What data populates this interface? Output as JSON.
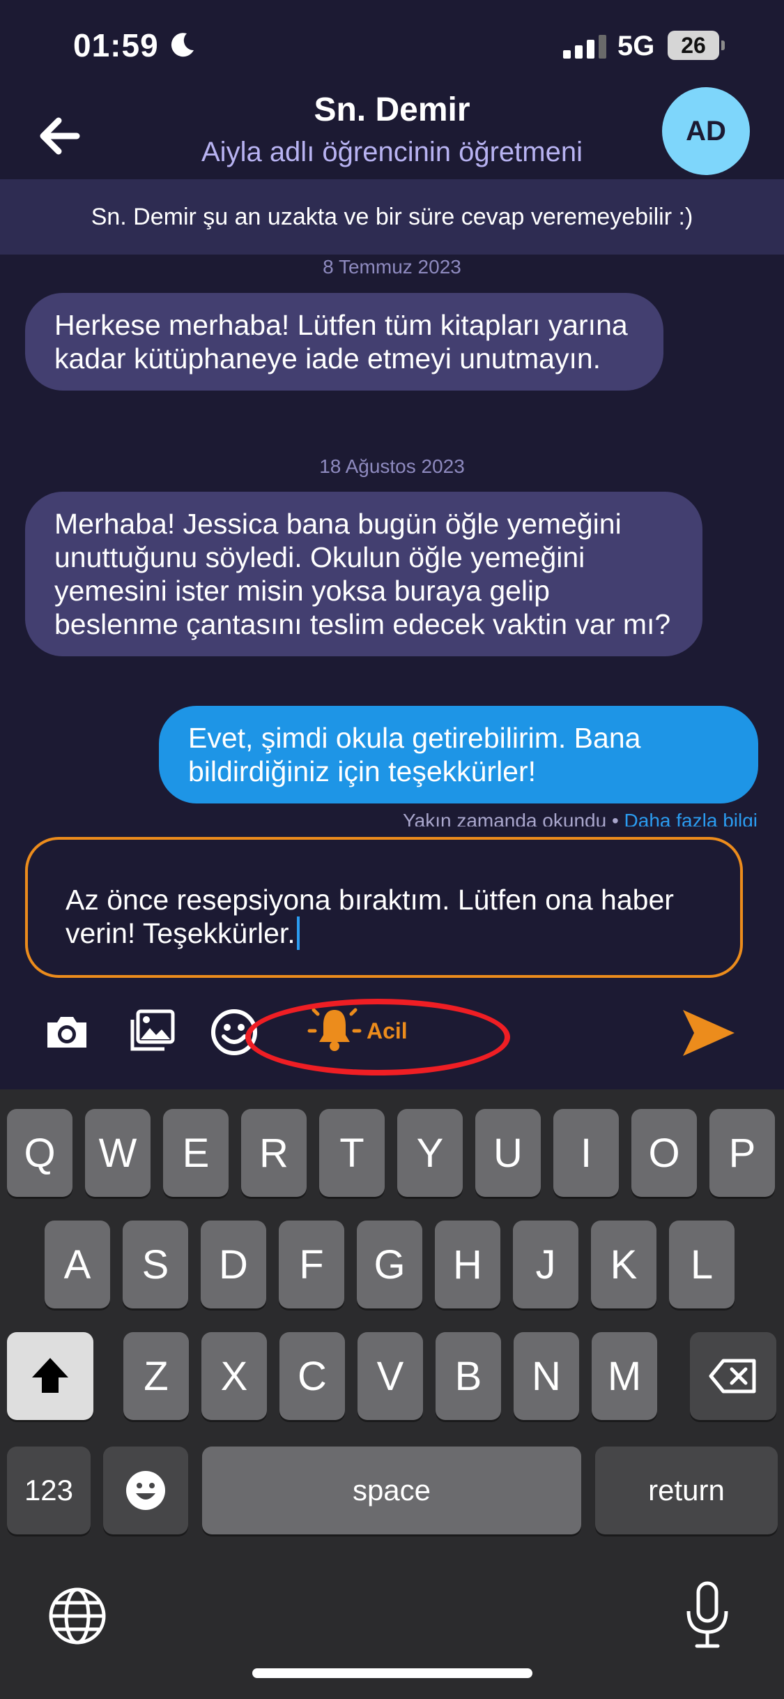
{
  "status_bar": {
    "time": "01:59",
    "network": "5G",
    "battery": "26"
  },
  "header": {
    "title": "Sn. Demir",
    "subtitle": "Aiyla adlı öğrencinin öğretmeni",
    "avatar_initials": "AD"
  },
  "banner": "Sn. Demir şu an uzakta ve bir süre cevap veremeyebilir :)",
  "messages": [
    {
      "date": "8 Temmuz 2023",
      "direction": "incoming",
      "text": "Herkese merhaba! Lütfen tüm kitapları yarına kadar kütüphaneye iade etmeyi unutmayın."
    },
    {
      "date": "18 Ağustos 2023",
      "direction": "incoming",
      "text": "Merhaba! Jessica bana bugün öğle yemeğini unuttuğunu söyledi. Okulun öğle yemeğini yemesini ister misin yoksa buraya gelip beslenme çantasını teslim edecek vaktin var mı?"
    },
    {
      "direction": "outgoing",
      "text": "Evet, şimdi okula getirebilirim. Bana bildirdiğiniz için teşekkürler!"
    }
  ],
  "read_status": {
    "text": "Yakın zamanda okundu",
    "separator": "•",
    "link": "Daha fazla bilgi"
  },
  "composer": {
    "text": "Az önce resepsiyona bıraktım. Lütfen ona haber verin! Teşekkürler."
  },
  "toolbar": {
    "icons": [
      "camera-icon",
      "gallery-icon",
      "emoji-icon",
      "bell-icon",
      "send-icon"
    ],
    "urgent_label": "Acil"
  },
  "keyboard": {
    "row1": [
      "Q",
      "W",
      "E",
      "R",
      "T",
      "Y",
      "U",
      "I",
      "O",
      "P"
    ],
    "row2": [
      "A",
      "S",
      "D",
      "F",
      "G",
      "H",
      "J",
      "K",
      "L"
    ],
    "row3": [
      "Z",
      "X",
      "C",
      "V",
      "B",
      "N",
      "M"
    ],
    "numbers_label": "123",
    "space_label": "space",
    "return_label": "return"
  },
  "colors": {
    "background": "#1c1a33",
    "accent": "#ec8c1c",
    "outgoing_bubble": "#1e95e6",
    "incoming_bubble": "#433f70",
    "highlight": "#ef1e24"
  }
}
